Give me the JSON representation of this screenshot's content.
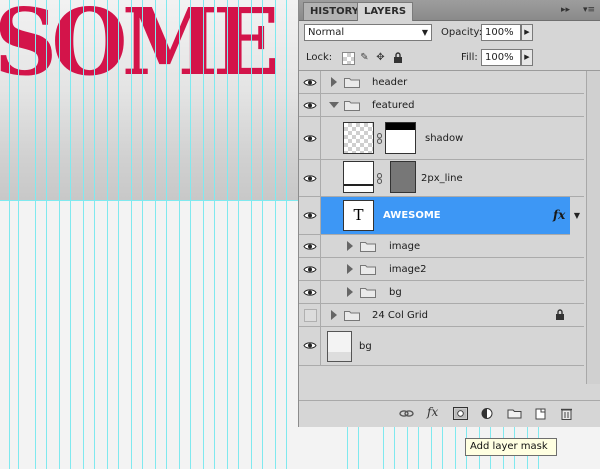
{
  "canvas": {
    "headline": "SOME",
    "headline_color": "#d3144a",
    "guide_color": "#7fe9ef"
  },
  "panel": {
    "tabs": [
      {
        "label": "HISTORY",
        "active": false
      },
      {
        "label": "LAYERS",
        "active": true
      }
    ],
    "menu_buttons": [
      "double-arrow-icon",
      "panel-menu-icon"
    ],
    "blend_mode": "Normal",
    "opacity_label": "Opacity:",
    "opacity_value": "100%",
    "lock_label": "Lock:",
    "fill_label": "Fill:",
    "fill_value": "100%",
    "layers": [
      {
        "name": "header",
        "type": "group",
        "expanded": false,
        "visible": true
      },
      {
        "name": "featured",
        "type": "group",
        "expanded": true,
        "visible": true
      },
      {
        "name": "shadow",
        "type": "layer-with-mask",
        "visible": true
      },
      {
        "name": "2px_line",
        "type": "layer-with-mask",
        "visible": true
      },
      {
        "name": "AWESOME",
        "type": "text",
        "visible": true,
        "selected": true,
        "effects": "fx"
      },
      {
        "name": "image",
        "type": "group",
        "expanded": false,
        "visible": true
      },
      {
        "name": "image2",
        "type": "group",
        "expanded": false,
        "visible": true
      },
      {
        "name": "bg",
        "type": "group",
        "expanded": false,
        "visible": true
      },
      {
        "name": "24 Col Grid",
        "type": "group",
        "expanded": false,
        "visible": false,
        "locked": true
      },
      {
        "name": "bg",
        "type": "background-layer",
        "visible": true
      }
    ],
    "text_thumb_glyph": "T",
    "fx_label": "fx",
    "footer_icons": [
      "link-layers-icon",
      "fx-icon",
      "add-layer-mask-icon",
      "adjustment-layer-icon",
      "new-group-icon",
      "new-layer-icon",
      "trash-icon"
    ],
    "footer_fx_label": "fx"
  },
  "tooltip": {
    "text": "Add layer mask"
  },
  "selection_color": "#3d97f5"
}
